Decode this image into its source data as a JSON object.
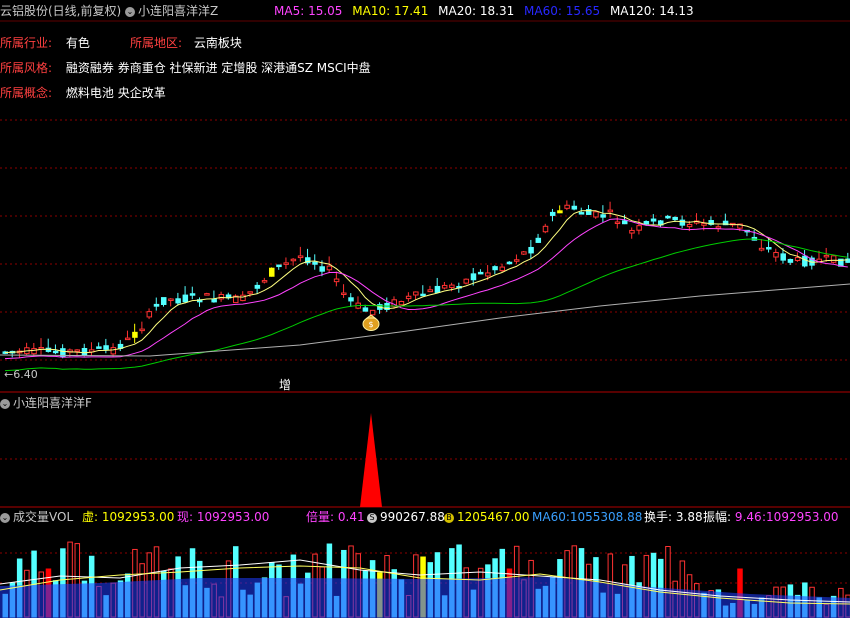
{
  "header": {
    "stock_title": "云铝股份(日线,前复权)",
    "indicator_name": "小连阳喜洋洋Z",
    "ma": [
      {
        "label": "MA5:",
        "value": "15.05",
        "color": "#ff44ff"
      },
      {
        "label": "MA10:",
        "value": "17.41",
        "color": "#ffff00"
      },
      {
        "label": "MA20:",
        "value": "18.31",
        "color": "#ffffff"
      },
      {
        "label": "MA60:",
        "value": "15.65",
        "color": "#2828ff"
      },
      {
        "label": "MA120:",
        "value": "14.13",
        "color": "#ffffff"
      }
    ]
  },
  "info": {
    "industry_label": "所属行业:",
    "industry_value": "有色",
    "region_label": "所属地区:",
    "region_value": "云南板块",
    "style_label": "所属风格:",
    "style_value": "融资融券 券商重仓 社保新进 定增股 深港通SZ MSCI中盘",
    "concept_label": "所属概念:",
    "concept_value": "燃料电池 央企改革"
  },
  "main_chart": {
    "low_price_label": "←6.40",
    "increase_marker": "增",
    "moneybag_icon": "money-bag-icon"
  },
  "panel2": {
    "indicator_name": "小连阳喜洋洋F"
  },
  "volume": {
    "indicator_name": "成交量VOL",
    "virtual_label": "虚:",
    "virtual_value": "1092953.00",
    "current_label": "现:",
    "current_value": "1092953.00",
    "ratio_label": "倍量:",
    "ratio_value": "0.41",
    "icon1_glyph": "S",
    "icon1_value": "990267.88",
    "icon2_glyph": "B",
    "icon2_value": "1205467.00",
    "ma60_label": "MA60:",
    "ma60_value": "1055308.88",
    "turnover_label": "换手:",
    "turnover_value": "3.88",
    "amplitude_label": "振幅:",
    "amplitude_value": "9.46",
    "tail_value": ":1092953.00"
  },
  "colors": {
    "up": "#ff3232",
    "down": "#54ffff",
    "ma5": "#ff44ff",
    "ma10": "#ffff00",
    "ma20": "#ffffff",
    "ma60": "#00cc00",
    "ma120": "#b0b0b0",
    "grid": "#8b0000",
    "vol_blue": "#1e3cff"
  }
}
